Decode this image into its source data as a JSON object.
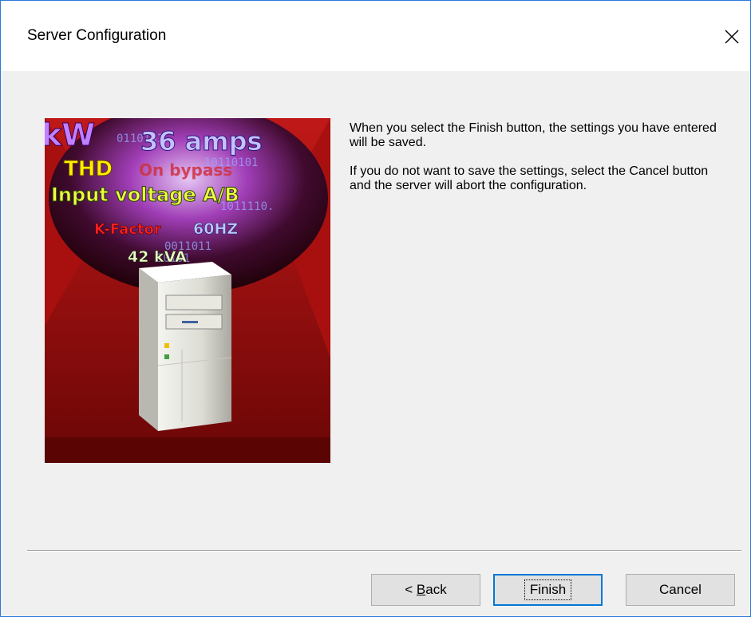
{
  "window": {
    "title": "Server Configuration",
    "close_glyph": "✕"
  },
  "message": {
    "paragraph_1": "When you select the Finish button, the settings you have entered will be saved.",
    "paragraph_2": "If you do not want to save the settings, select the Cancel button and the server will abort the configuration."
  },
  "illustration": {
    "label_kw": "kW",
    "label_amps": "36 amps",
    "label_thd": "THD",
    "label_on_bypass": "On bypass",
    "label_input_voltage": "Input voltage A/B",
    "label_k_factor": "K-Factor",
    "label_60hz": "60HZ",
    "label_kva": "42 kVA"
  },
  "buttons": {
    "back_accel": "B",
    "back_rest": "ack",
    "back_prefix": "< ",
    "finish": "Finish",
    "cancel": "Cancel"
  }
}
